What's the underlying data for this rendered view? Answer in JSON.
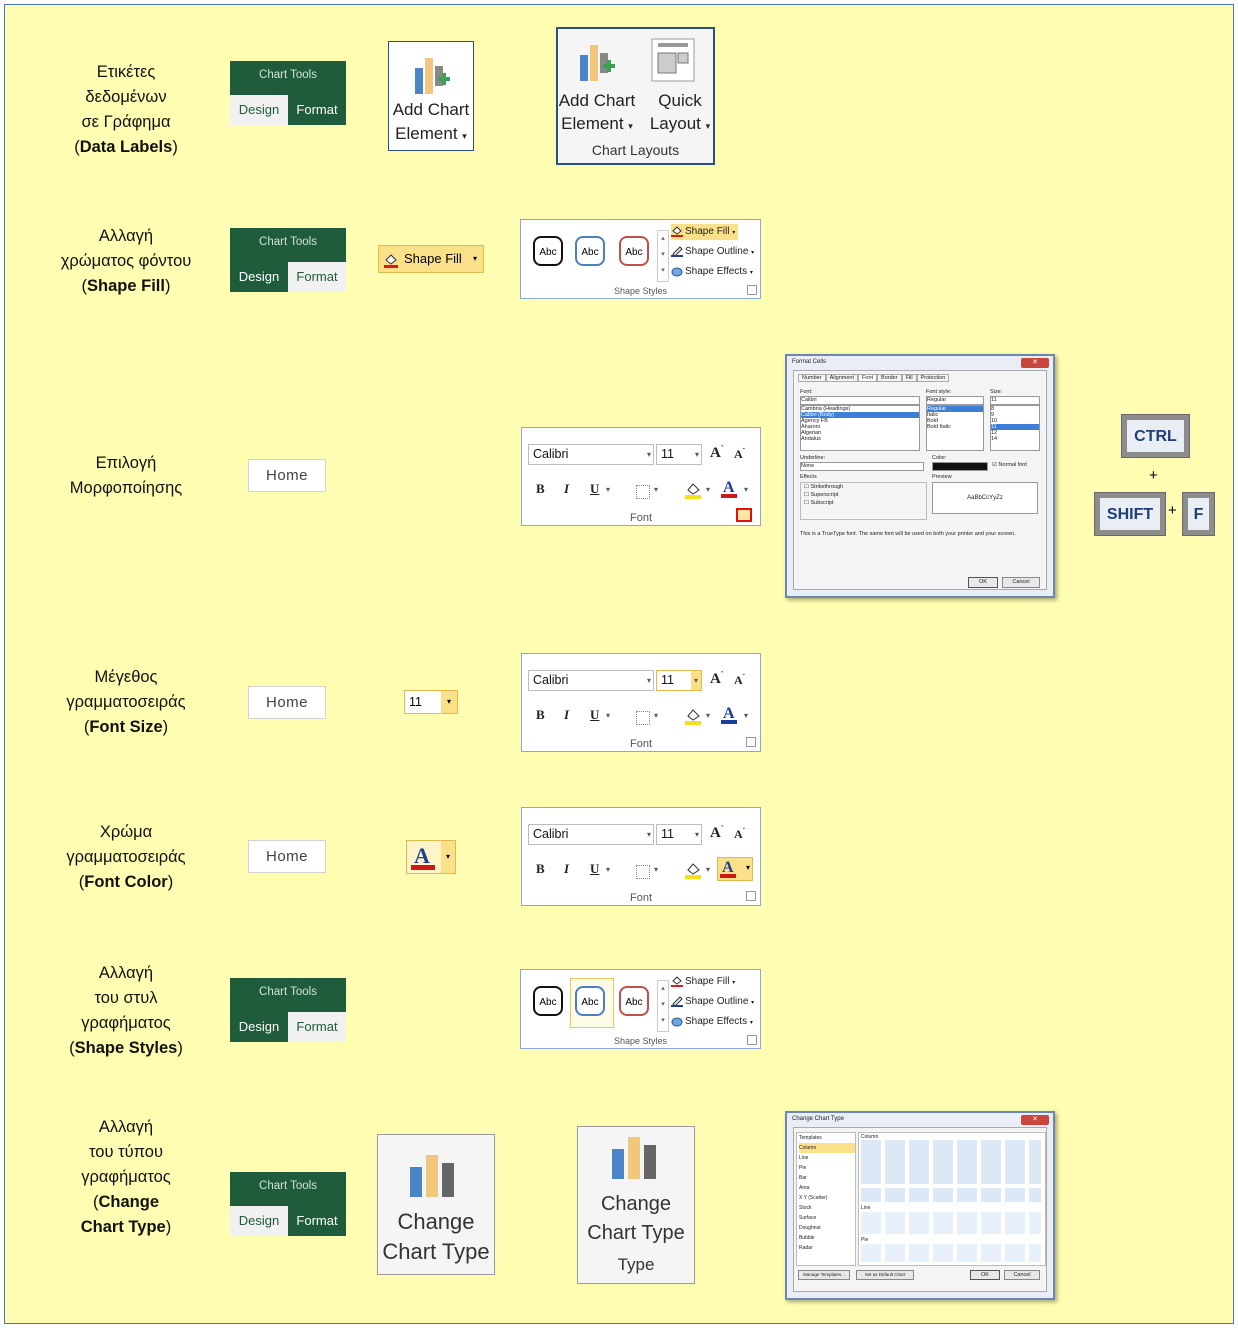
{
  "rows": [
    {
      "label_lines": [
        "Ετικέτες δεδομένων",
        "σε Γράφημα"
      ],
      "label_bold": "Data Labels"
    },
    {
      "label_lines": [
        "Αλλαγή",
        "χρώματος φόντου"
      ],
      "label_bold": "Shape Fill"
    },
    {
      "label_lines": [
        "Επιλογή",
        "Μορφοποίησης"
      ],
      "label_bold": ""
    },
    {
      "label_lines": [
        "Μέγεθος",
        "γραμματοσειράς"
      ],
      "label_bold": "Font Size"
    },
    {
      "label_lines": [
        "Χρώμα",
        "γραμματοσειράς"
      ],
      "label_bold": "Font Color"
    },
    {
      "label_lines": [
        "Αλλαγή",
        "του στυλ",
        "γραφήματος"
      ],
      "label_bold": "Shape Styles"
    },
    {
      "label_lines": [
        "Αλλαγή",
        "του τύπου",
        "γραφήματος"
      ],
      "label_bold_lines": [
        "Change",
        "Chart Type"
      ]
    }
  ],
  "chart_tools": {
    "title": "Chart Tools",
    "design": "Design",
    "format": "Format"
  },
  "home_tab": "Home",
  "add_chart_element": {
    "line1": "Add Chart",
    "line2": "Element"
  },
  "quick_layout": {
    "line1": "Quick",
    "line2": "Layout"
  },
  "chart_layouts_group": "Chart Layouts",
  "shape_fill": "Shape Fill",
  "shape_outline": "Shape Outline",
  "shape_effects": "Shape Effects",
  "shape_styles_group": "Shape Styles",
  "abc": "Abc",
  "font_group": {
    "font_name": "Calibri",
    "font_size": "11",
    "bold": "B",
    "italic": "I",
    "underline": "U",
    "grow": "A",
    "shrink": "A",
    "label": "Font"
  },
  "format_cells": {
    "title": "Format Cells",
    "tabs": [
      "Number",
      "Alignment",
      "Font",
      "Border",
      "Fill",
      "Protection"
    ],
    "font_label": "Font:",
    "font_value": "Calibri",
    "font_list": [
      "Cambria (Headings)",
      "Calibri (Body)",
      "Agency FB",
      "Aharoni",
      "Algerian",
      "Andalus"
    ],
    "style_label": "Font style:",
    "style_value": "Regular",
    "style_list": [
      "Regular",
      "Italic",
      "Bold",
      "Bold Italic"
    ],
    "size_label": "Size:",
    "size_value": "11",
    "size_list": [
      "8",
      "9",
      "10",
      "11",
      "12",
      "14"
    ],
    "underline_label": "Underline:",
    "underline_value": "None",
    "color_label": "Color:",
    "normal_font": "Normal font",
    "effects_label": "Effects",
    "effects": [
      "Strikethrough",
      "Superscript",
      "Subscript"
    ],
    "preview_label": "Preview",
    "preview_text": "AaBbCcYyZz",
    "note": "This is a TrueType font.  The same font will be used on both your printer and your screen.",
    "ok": "OK",
    "cancel": "Cancel"
  },
  "shortcut": {
    "ctrl": "CTRL",
    "plus1": "+",
    "shift": "SHIFT",
    "plus2": "+",
    "f": "F"
  },
  "change_chart_type_big": {
    "line1": "Change",
    "line2": "Chart Type"
  },
  "change_chart_type_big2": {
    "line1": "Change",
    "line2": "Chart Type",
    "line3": "Type"
  },
  "change_chart_dialog": {
    "title": "Change Chart Type",
    "types": [
      "Templates",
      "Column",
      "Line",
      "Pie",
      "Bar",
      "Area",
      "X Y (Scatter)",
      "Stock",
      "Surface",
      "Doughnut",
      "Bubble",
      "Radar"
    ],
    "section_column": "Column",
    "section_line": "Line",
    "section_pie": "Pie",
    "manage": "Manage Templates...",
    "set_default": "Set as Default Chart",
    "ok": "OK",
    "cancel": "Cancel"
  },
  "colors": {
    "background": "#fefdb1",
    "border": "#4a74b7",
    "chart_tools_green": "#1e5c3b",
    "highlight": "#fbe08a"
  }
}
